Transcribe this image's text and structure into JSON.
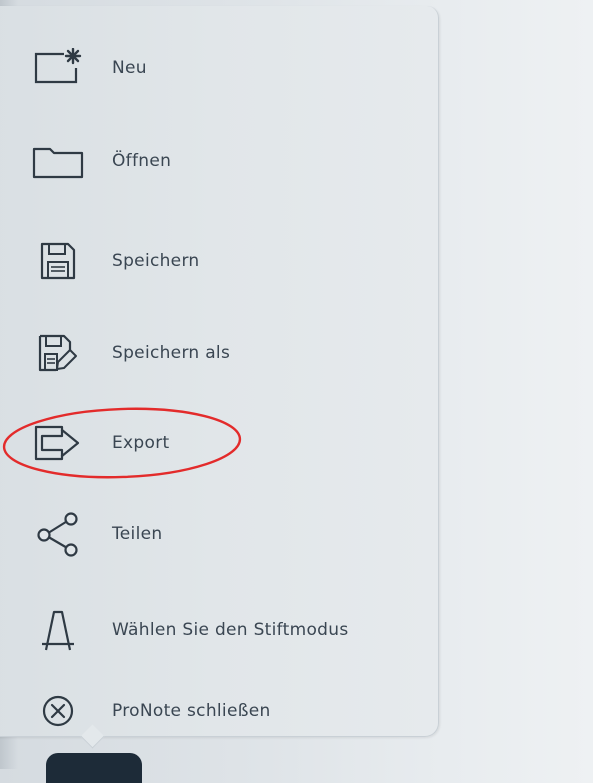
{
  "menu": {
    "items": [
      {
        "id": "new",
        "label": "Neu",
        "icon": "new-file-icon"
      },
      {
        "id": "open",
        "label": "Öffnen",
        "icon": "folder-icon"
      },
      {
        "id": "save",
        "label": "Speichern",
        "icon": "save-icon"
      },
      {
        "id": "save_as",
        "label": "Speichern als",
        "icon": "save-as-icon"
      },
      {
        "id": "export",
        "label": "Export",
        "icon": "export-icon"
      },
      {
        "id": "share",
        "label": "Teilen",
        "icon": "share-icon"
      },
      {
        "id": "pen_mode",
        "label": "Wählen Sie den Stiftmodus",
        "icon": "pen-mode-icon"
      },
      {
        "id": "close",
        "label": "ProNote schließen",
        "icon": "close-circle-icon"
      }
    ],
    "highlighted_item": "export"
  },
  "colors": {
    "icon_stroke": "#2f3a44",
    "label_text": "#3a4652",
    "highlight": "#e32b2b",
    "panel_background": "#e1e6e9"
  }
}
